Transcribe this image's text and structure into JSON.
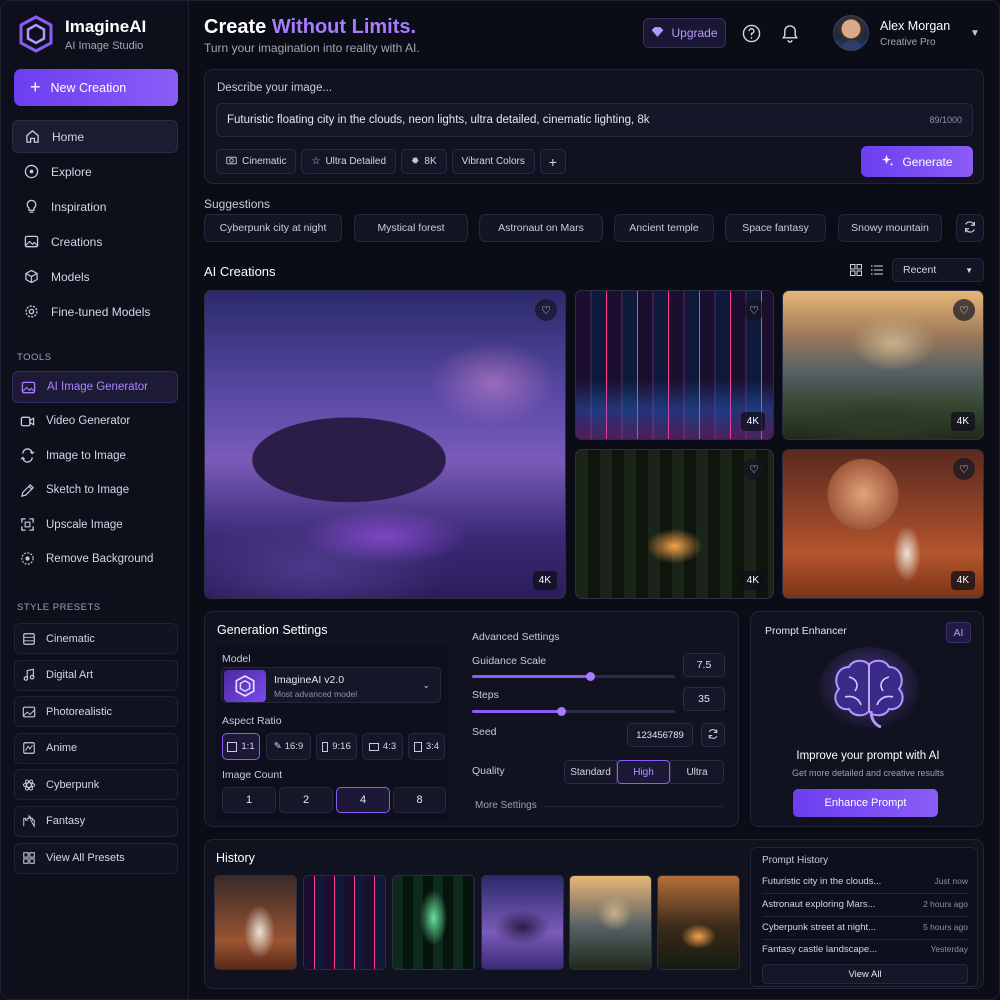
{
  "brand": {
    "name": "ImagineAI",
    "subtitle": "AI Image Studio"
  },
  "sidebar": {
    "new_button": "New Creation",
    "nav": [
      {
        "label": "Home",
        "icon": "home-icon",
        "active": true
      },
      {
        "label": "Explore",
        "icon": "compass-icon"
      },
      {
        "label": "Inspiration",
        "icon": "lightbulb-icon"
      },
      {
        "label": "Creations",
        "icon": "image-icon"
      },
      {
        "label": "Models",
        "icon": "cube-icon"
      },
      {
        "label": "Fine-tuned Models",
        "icon": "gear-icon"
      }
    ],
    "tools_label": "TOOLS",
    "tools": [
      {
        "label": "AI Image Generator",
        "icon": "image-icon",
        "active": true
      },
      {
        "label": "Video Generator",
        "icon": "video-icon"
      },
      {
        "label": "Image to Image",
        "icon": "swap-icon"
      },
      {
        "label": "Sketch to Image",
        "icon": "pen-icon"
      },
      {
        "label": "Upscale Image",
        "icon": "expand-icon"
      },
      {
        "label": "Remove Background",
        "icon": "magic-icon"
      }
    ],
    "presets_label": "STYLE PRESETS",
    "presets": [
      {
        "label": "Cinematic",
        "icon": "film-icon"
      },
      {
        "label": "Digital Art",
        "icon": "music-note-icon"
      },
      {
        "label": "Photorealistic",
        "icon": "photo-icon"
      },
      {
        "label": "Anime",
        "icon": "anime-icon"
      },
      {
        "label": "Cyberpunk",
        "icon": "atom-icon"
      },
      {
        "label": "Fantasy",
        "icon": "castle-icon"
      },
      {
        "label": "View All Presets",
        "icon": "grid-icon"
      }
    ]
  },
  "header": {
    "title_prefix": "Create ",
    "title_accent": "Without Limits.",
    "subtitle": "Turn your imagination into reality with AI.",
    "upgrade_label": "Upgrade",
    "user_name": "Alex Morgan",
    "user_role": "Creative Pro"
  },
  "prompt": {
    "label": "Describe your image...",
    "value": "Futuristic floating city in the clouds, neon lights, ultra detailed, cinematic lighting, 8k",
    "count": "89/1000",
    "chips": [
      {
        "label": "Cinematic",
        "icon": "camera-icon"
      },
      {
        "label": "Ultra Detailed",
        "icon": "star-icon"
      },
      {
        "label": "8K",
        "icon": "sun-icon"
      },
      {
        "label": "Vibrant Colors",
        "icon": ""
      }
    ],
    "generate_label": "Generate"
  },
  "suggestions": {
    "label": "Suggestions",
    "items": [
      "Cyberpunk city at night",
      "Mystical forest",
      "Astronaut on Mars",
      "Ancient temple",
      "Space fantasy",
      "Snowy mountain"
    ]
  },
  "creations": {
    "title": "AI Creations",
    "sort": "Recent",
    "badge": "4K"
  },
  "generation": {
    "title": "Generation Settings",
    "model_label": "Model",
    "model_name": "ImagineAI v2.0",
    "model_sub": "Most advanced model",
    "aspect_label": "Aspect Ratio",
    "aspects": [
      "1:1",
      "16:9",
      "9:16",
      "4:3",
      "3:4"
    ],
    "aspect_selected": "1:1",
    "count_label": "Image Count",
    "counts": [
      "1",
      "2",
      "4",
      "8"
    ],
    "count_selected": "4",
    "advanced_title": "Advanced Settings",
    "guidance_label": "Guidance Scale",
    "guidance_value": "7.5",
    "guidance_fraction": 0.58,
    "steps_label": "Steps",
    "steps_value": "35",
    "steps_fraction": 0.44,
    "seed_label": "Seed",
    "seed_value": "123456789",
    "quality_label": "Quality",
    "qualities": [
      "Standard",
      "High",
      "Ultra"
    ],
    "quality_selected": "High",
    "more_settings": "More Settings"
  },
  "enhancer": {
    "title": "Prompt Enhancer",
    "badge": "AI",
    "heading": "Improve your prompt with AI",
    "sub": "Get more detailed and creative results",
    "button": "Enhance Prompt"
  },
  "history": {
    "title": "History",
    "prompt_history_title": "Prompt History",
    "items": [
      {
        "text": "Futuristic city in the clouds...",
        "time": "Just now"
      },
      {
        "text": "Astronaut exploring Mars...",
        "time": "2 hours ago"
      },
      {
        "text": "Cyberpunk street at night...",
        "time": "5 hours ago"
      },
      {
        "text": "Fantasy castle landscape...",
        "time": "Yesterday"
      }
    ],
    "view_all": "View All"
  },
  "colors": {
    "accent": "#8b5cf6",
    "accent_text": "#a87bff",
    "background": "#0a0c16",
    "card": "#10121f"
  }
}
